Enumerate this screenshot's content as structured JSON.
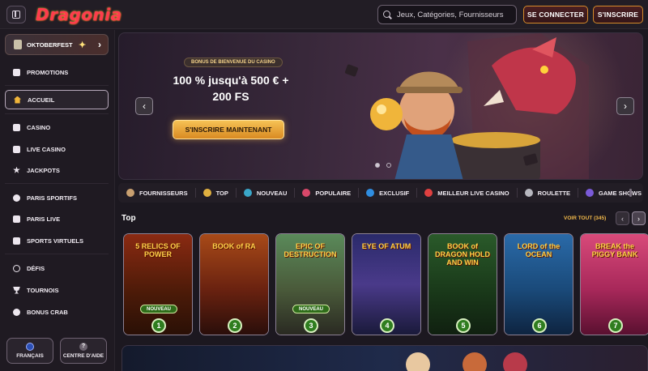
{
  "header": {
    "brand": "Dragonia",
    "search_placeholder": "Jeux, Catégories, Fournisseurs",
    "login_label": "SE CONNECTER",
    "signup_label": "S'INSCRIRE"
  },
  "sidebar": {
    "promo_label": "OKTOBERFEST",
    "items": [
      {
        "label": "PROMOTIONS",
        "icon": "gift-icon"
      },
      {
        "label": "ACCUEIL",
        "icon": "home-icon",
        "active": true
      },
      {
        "label": "CASINO",
        "icon": "slot-icon"
      },
      {
        "label": "LIVE CASINO",
        "icon": "cards-icon"
      },
      {
        "label": "JACKPOTS",
        "icon": "clover-icon"
      },
      {
        "label": "PARIS SPORTIFS",
        "icon": "ball-icon"
      },
      {
        "label": "PARIS LIVE",
        "icon": "live-icon"
      },
      {
        "label": "SPORTS VIRTUELS",
        "icon": "screen-icon"
      },
      {
        "label": "DÉFIS",
        "icon": "target-icon"
      },
      {
        "label": "TOURNOIS",
        "icon": "trophy-icon"
      },
      {
        "label": "BONUS CRAB",
        "icon": "crab-icon"
      }
    ],
    "language_label": "FRANÇAIS",
    "help_label": "CENTRE D'AIDE"
  },
  "banner": {
    "tag": "BONUS DE BIENVENUE DU CASINO",
    "title_line1": "100 % jusqu'à 500 € +",
    "title_line2": "200 FS",
    "cta": "S'INSCRIRE MAINTENANT"
  },
  "categories": [
    {
      "label": "FOURNISSEURS",
      "color": "#c9a070"
    },
    {
      "label": "TOP",
      "color": "#e0b040"
    },
    {
      "label": "NOUVEAU",
      "color": "#3aa6c8"
    },
    {
      "label": "POPULAIRE",
      "color": "#d8486a"
    },
    {
      "label": "EXCLUSIF",
      "color": "#2f8de0"
    },
    {
      "label": "MEILLEUR LIVE CASINO",
      "color": "#e04040"
    },
    {
      "label": "ROULETTE",
      "color": "#b8b8c0"
    },
    {
      "label": "GAME SHOWS",
      "color": "#7a5ad8"
    }
  ],
  "section": {
    "title": "Top",
    "see_all": "VOIR TOUT (345)"
  },
  "games": [
    {
      "title": "5 RELICS OF POWER",
      "rank": "1",
      "badge": "NOUVEAU",
      "bg": "#6a3a12"
    },
    {
      "title": "BOOK of RA",
      "rank": "2",
      "badge": "",
      "bg": "#7a2a14"
    },
    {
      "title": "EPIC OF DESTRUCTION",
      "rank": "3",
      "badge": "NOUVEAU",
      "bg": "#4b6a3a"
    },
    {
      "title": "EYE OF ATUM",
      "rank": "4",
      "badge": "",
      "bg": "#3a3a7a"
    },
    {
      "title": "BOOK of DRAGON HOLD AND WIN",
      "rank": "5",
      "badge": "",
      "bg": "#2f4a2a"
    },
    {
      "title": "LORD of the OCEAN",
      "rank": "6",
      "badge": "",
      "bg": "#1f4f7a"
    },
    {
      "title": "BREAK the PIGGY BANK",
      "rank": "7",
      "badge": "",
      "bg": "#b83a6a"
    }
  ]
}
